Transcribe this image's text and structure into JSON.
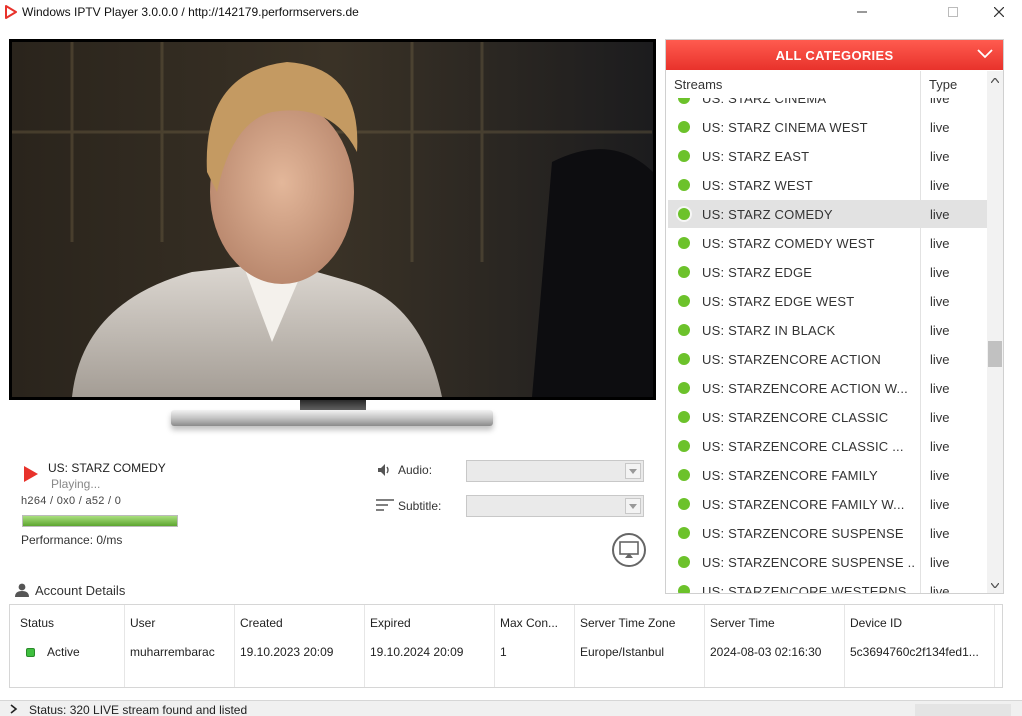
{
  "window": {
    "title": "Windows IPTV Player 3.0.0.0 / http://142179.performservers.de",
    "accent": "#e8322b"
  },
  "player": {
    "now_playing": "US: STARZ COMEDY",
    "status": "Playing...",
    "codec": "h264 / 0x0 / a52  / 0",
    "buffer_progress": 1.0,
    "performance": "Performance: 0/ms",
    "audio_label": "Audio:",
    "subtitle_label": "Subtitle:",
    "audio_value": "",
    "subtitle_value": ""
  },
  "streams": {
    "category": "ALL CATEGORIES",
    "col_streams": "Streams",
    "col_type": "Type",
    "items": [
      {
        "name": "US: STARZ CINEMA",
        "type": "live"
      },
      {
        "name": "US: STARZ CINEMA WEST",
        "type": "live"
      },
      {
        "name": "US: STARZ EAST",
        "type": "live"
      },
      {
        "name": "US: STARZ WEST",
        "type": "live"
      },
      {
        "name": "US: STARZ COMEDY",
        "type": "live"
      },
      {
        "name": "US: STARZ COMEDY WEST",
        "type": "live"
      },
      {
        "name": "US: STARZ EDGE",
        "type": "live"
      },
      {
        "name": "US: STARZ EDGE WEST",
        "type": "live"
      },
      {
        "name": "US: STARZ IN BLACK",
        "type": "live"
      },
      {
        "name": "US: STARZENCORE ACTION",
        "type": "live"
      },
      {
        "name": "US: STARZENCORE ACTION W...",
        "type": "live"
      },
      {
        "name": "US: STARZENCORE CLASSIC",
        "type": "live"
      },
      {
        "name": "US: STARZENCORE CLASSIC ...",
        "type": "live"
      },
      {
        "name": "US: STARZENCORE FAMILY",
        "type": "live"
      },
      {
        "name": "US: STARZENCORE FAMILY W...",
        "type": "live"
      },
      {
        "name": "US: STARZENCORE SUSPENSE",
        "type": "live"
      },
      {
        "name": "US: STARZENCORE SUSPENSE ...",
        "type": "live"
      },
      {
        "name": "US: STARZENCORE WESTERNS",
        "type": "live"
      }
    ]
  },
  "account": {
    "title": "Account Details",
    "headers": [
      "Status",
      "User",
      "Created",
      "Expired",
      "Max Con...",
      "Server Time Zone",
      "Server Time",
      "Device ID"
    ],
    "values": [
      "Active",
      "muharrembarac",
      "19.10.2023 20:09",
      "19.10.2024 20:09",
      "1",
      "Europe/Istanbul",
      "2024-08-03 02:16:30",
      "5c3694760c2f134fed1..."
    ]
  },
  "statusbar": {
    "text": "Status: 320 LIVE stream found and listed"
  }
}
